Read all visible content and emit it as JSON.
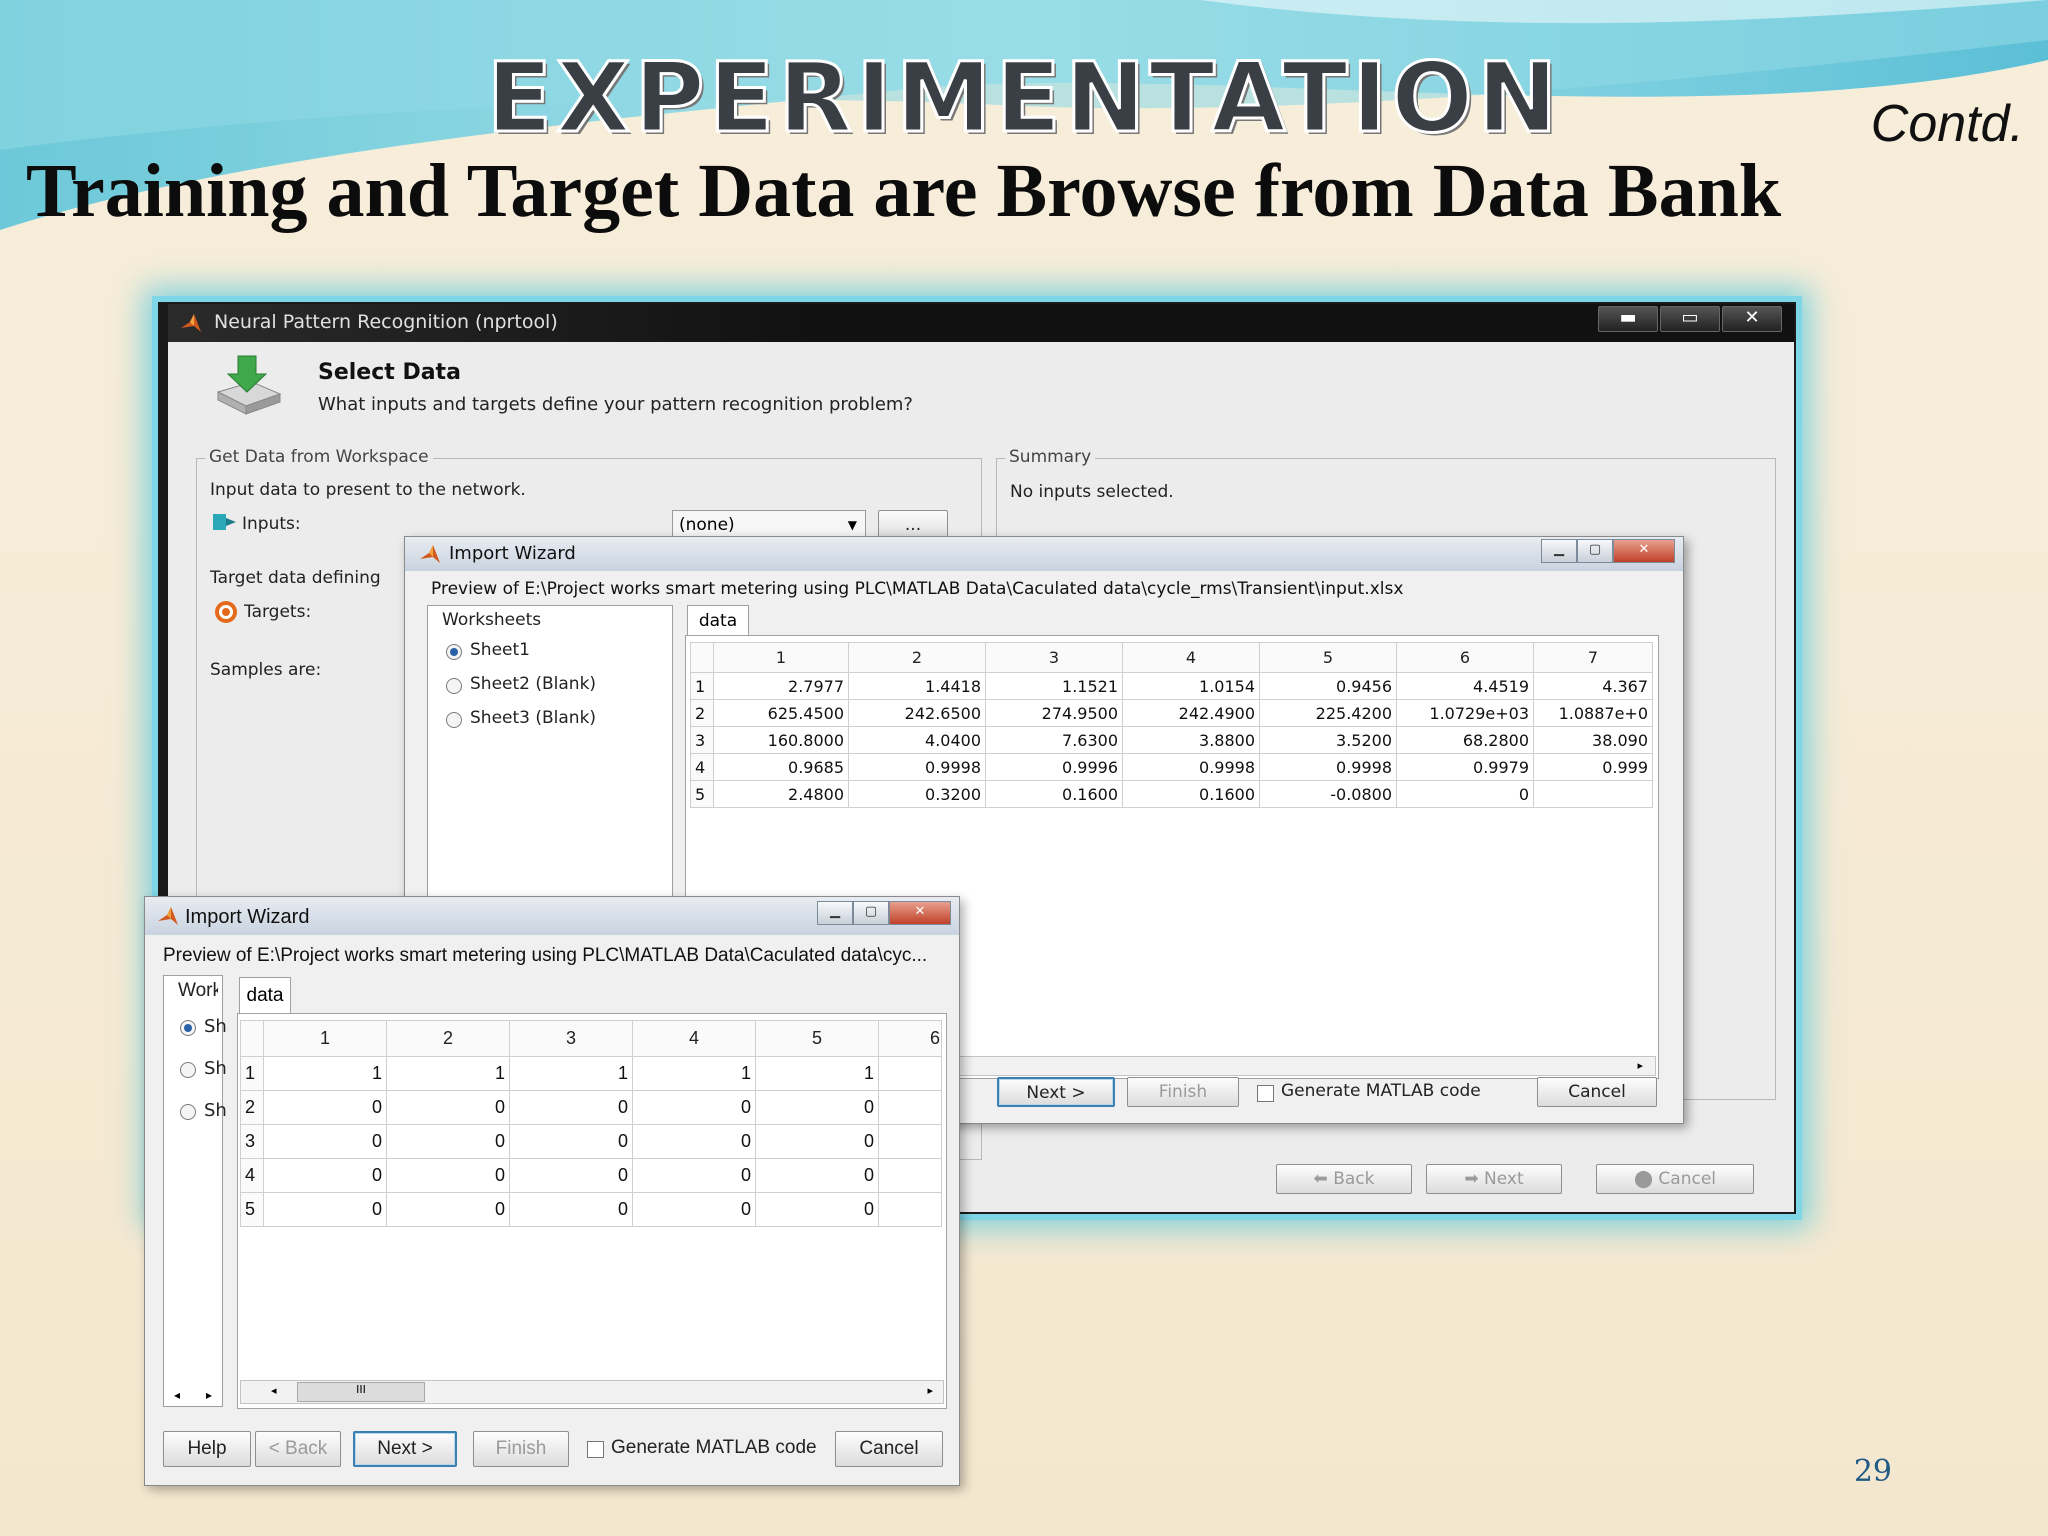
{
  "slide": {
    "heading": "EXPERIMENTATION",
    "contd": "Contd.",
    "subtitle": "Training and Target Data  are Browse from Data Bank",
    "page_number": "29"
  },
  "colors": {
    "sky": "#7fd3e2",
    "frame_glow": "#7ed6e6",
    "window_bg": "#ececec"
  },
  "main_window": {
    "title": "Neural Pattern Recognition (nprtool)",
    "controls": [
      "minimize-icon",
      "maximize-icon",
      "close-icon"
    ],
    "section_title": "Select Data",
    "section_sub": "What inputs and targets define your pattern recognition problem?",
    "get_data_group": "Get Data from Workspace",
    "input_desc": "Input data to present to the network.",
    "inputs_label": "Inputs:",
    "inputs_value": "(none)",
    "ellipsis": "...",
    "target_desc": "Target data defining",
    "targets_label": "Targets:",
    "samples_label": "Samples are:",
    "summary_group": "Summary",
    "summary_text": "No inputs selected.",
    "back": "Back",
    "next": "Next",
    "cancel": "Cancel"
  },
  "wizard_back": {
    "title": "Import Wizard",
    "preview": "Preview of E:\\Project works smart metering using PLC\\MATLAB Data\\Caculated data\\cycle_rms\\Transient\\input.xlsx",
    "worksheets_label": "Worksheets",
    "sheets": [
      {
        "label": "Sheet1"
      },
      {
        "label": "Sheet2 (Blank)"
      },
      {
        "label": "Sheet3 (Blank)"
      }
    ],
    "tab": "data",
    "columns": [
      "1",
      "2",
      "3",
      "4",
      "5",
      "6",
      "7"
    ],
    "rows": [
      {
        "h": "1",
        "cells": [
          "2.7977",
          "1.4418",
          "1.1521",
          "1.0154",
          "0.9456",
          "4.4519",
          "4.367"
        ]
      },
      {
        "h": "2",
        "cells": [
          "625.4500",
          "242.6500",
          "274.9500",
          "242.4900",
          "225.4200",
          "1.0729e+03",
          "1.0887e+0"
        ]
      },
      {
        "h": "3",
        "cells": [
          "160.8000",
          "4.0400",
          "7.6300",
          "3.8800",
          "3.5200",
          "68.2800",
          "38.090"
        ]
      },
      {
        "h": "4",
        "cells": [
          "0.9685",
          "0.9998",
          "0.9996",
          "0.9998",
          "0.9998",
          "0.9979",
          "0.999"
        ]
      },
      {
        "h": "5",
        "cells": [
          "2.4800",
          "0.3200",
          "0.1600",
          "0.1600",
          "-0.0800",
          "0",
          ""
        ]
      }
    ],
    "next": "Next >",
    "finish": "Finish",
    "gen_code": "Generate MATLAB code",
    "cancel": "Cancel"
  },
  "wizard_front": {
    "title": "Import Wizard",
    "preview": "Preview of E:\\Project works smart metering using PLC\\MATLAB Data\\Caculated data\\cyc...",
    "worksheets_label": "Works",
    "sheets": [
      {
        "label": "Sh"
      },
      {
        "label": "Sh"
      },
      {
        "label": "Sh"
      }
    ],
    "tab": "data",
    "columns": [
      "1",
      "2",
      "3",
      "4",
      "5",
      "6"
    ],
    "rows": [
      {
        "h": "1",
        "cells": [
          "1",
          "1",
          "1",
          "1",
          "1",
          ""
        ]
      },
      {
        "h": "2",
        "cells": [
          "0",
          "0",
          "0",
          "0",
          "0",
          ""
        ]
      },
      {
        "h": "3",
        "cells": [
          "0",
          "0",
          "0",
          "0",
          "0",
          ""
        ]
      },
      {
        "h": "4",
        "cells": [
          "0",
          "0",
          "0",
          "0",
          "0",
          ""
        ]
      },
      {
        "h": "5",
        "cells": [
          "0",
          "0",
          "0",
          "0",
          "0",
          ""
        ]
      }
    ],
    "scroll_thumb": "III",
    "help": "Help",
    "back": "< Back",
    "next": "Next >",
    "finish": "Finish",
    "gen_code": "Generate MATLAB code",
    "cancel": "Cancel"
  }
}
